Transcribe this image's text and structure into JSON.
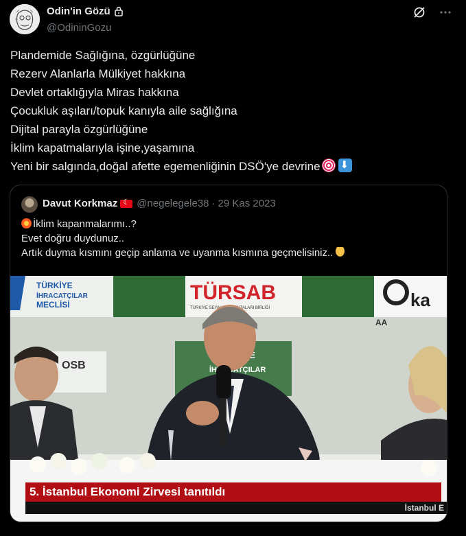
{
  "tweet": {
    "display_name": "Odin'in Gözü",
    "handle": "@OdininGozu",
    "lines": [
      "Plandemide Sağlığına, özgürlüğüne",
      "Rezerv Alanlarla Mülkiyet hakkına",
      "Devlet ortaklığıyla Miras hakkına",
      "Çocukluk aşıları/topuk kanıyla aile sağlığına",
      "Dijital parayla özgürlüğüne",
      "İklim kapatmalarıyla işine,yaşamına",
      "Yeni bir salgında,doğal afette egemenliğinin DSÖ'ye devrine"
    ],
    "icons": [
      "lock-icon",
      "grok-icon",
      "more-icon",
      "direct-hit-emoji",
      "down-arrow-emoji"
    ]
  },
  "quote": {
    "display_name": "Davut Korkmaz",
    "handle": "@negelegele38",
    "separator": "·",
    "date": "29 Kas 2023",
    "lines": [
      "İklim kapanmalarımı..?",
      "Evet doğru duydunuz..",
      "Artık duyma kısmını geçip anlama ve uyanma kısmına geçmelisiniz.."
    ],
    "icons": [
      "turkey-flag-emoji",
      "collision-emoji",
      "backhand-down-emoji"
    ]
  },
  "video": {
    "banner_left": "TÜRKİYE\nİHRACATÇILAR\nMECLİSİ",
    "banner_center": "TÜRSAB",
    "banner_center_sub": "TÜRKİYE SEYAHAT ACENTALARI BİRLİĞİ",
    "banner_right": "ka",
    "ticker": "5. İstanbul Ekonomi Zirvesi tanıtıldı",
    "ticker_sub": "İstanbul E",
    "colors": {
      "ticker_bg": "#b10f14",
      "banner_green": "#2e6b35",
      "tursab_red": "#d2232a"
    }
  }
}
